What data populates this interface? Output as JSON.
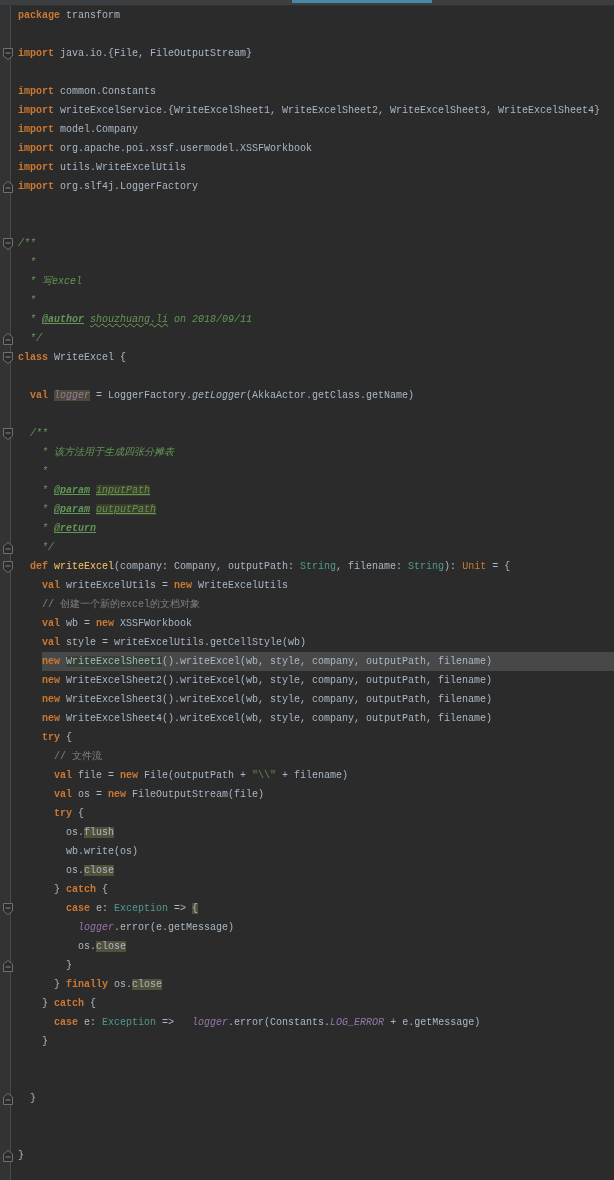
{
  "editor": {
    "lines": [
      {
        "kind": "code",
        "current": false,
        "tokens": [
          {
            "kind": "keyword",
            "text": "package"
          },
          {
            "kind": "plain",
            "text": " transform"
          }
        ]
      },
      {
        "kind": "blank",
        "current": false
      },
      {
        "kind": "code",
        "current": false,
        "fold_start": true,
        "tokens": [
          {
            "kind": "keyword",
            "text": "import"
          },
          {
            "kind": "plain",
            "text": " java.io.{File, FileOutputStream}"
          }
        ]
      },
      {
        "kind": "blank",
        "current": false
      },
      {
        "kind": "code",
        "current": false,
        "tokens": [
          {
            "kind": "keyword",
            "text": "import"
          },
          {
            "kind": "plain",
            "text": " common.Constants"
          }
        ]
      },
      {
        "kind": "code",
        "current": false,
        "tokens": [
          {
            "kind": "keyword",
            "text": "import"
          },
          {
            "kind": "plain",
            "text": " writeExcelService.{WriteExcelSheet1, WriteExcelSheet2, WriteExcelSheet3, WriteExcelSheet4}"
          }
        ]
      },
      {
        "kind": "code",
        "current": false,
        "tokens": [
          {
            "kind": "keyword",
            "text": "import"
          },
          {
            "kind": "plain",
            "text": " model.Company"
          }
        ]
      },
      {
        "kind": "code",
        "current": false,
        "tokens": [
          {
            "kind": "keyword",
            "text": "import"
          },
          {
            "kind": "plain",
            "text": " org.apache.poi.xssf.usermodel.XSSFWorkbook"
          }
        ]
      },
      {
        "kind": "code",
        "current": false,
        "tokens": [
          {
            "kind": "keyword",
            "text": "import"
          },
          {
            "kind": "plain",
            "text": " utils.WriteExcelUtils"
          }
        ]
      },
      {
        "kind": "code",
        "current": false,
        "fold_end": true,
        "tokens": [
          {
            "kind": "keyword",
            "text": "import"
          },
          {
            "kind": "plain",
            "text": " org.slf4j.LoggerFactory"
          }
        ]
      },
      {
        "kind": "blank",
        "current": false
      },
      {
        "kind": "blank",
        "current": false
      },
      {
        "kind": "code",
        "current": false,
        "fold_start": true,
        "tokens": [
          {
            "kind": "doc",
            "text": "/**"
          }
        ],
        "children": [
          {
            "kind": "code",
            "current": false,
            "tokens": [
              {
                "kind": "doc",
                "text": "*"
              }
            ]
          },
          {
            "kind": "code",
            "current": false,
            "tokens": [
              {
                "kind": "doc",
                "text": "* 写excel"
              }
            ]
          },
          {
            "kind": "code",
            "current": false,
            "tokens": [
              {
                "kind": "doc",
                "text": "*"
              }
            ]
          },
          {
            "kind": "code",
            "current": false,
            "tokens": [
              {
                "kind": "doc",
                "text": "* "
              },
              {
                "kind": "doc_tag",
                "text": "@author"
              },
              {
                "kind": "doc_misspelt",
                "text": "shouzhuang.li"
              },
              {
                "kind": "doc",
                "text": " on 2018/09/11"
              }
            ]
          },
          {
            "kind": "code",
            "current": false,
            "fold_end": true,
            "tokens": [
              {
                "kind": "doc",
                "text": "*/"
              }
            ]
          }
        ]
      },
      {
        "kind": "code",
        "current": false,
        "fold_start": true,
        "tokens": [
          {
            "kind": "keyword",
            "text": "class"
          },
          {
            "kind": "plain",
            "text": " WriteExcel {"
          }
        ],
        "children": [
          {
            "kind": "blank",
            "current": false
          },
          {
            "kind": "code",
            "current": false,
            "tokens": [
              {
                "kind": "keyword",
                "text": "val "
              },
              {
                "kind": "field_declaration",
                "text": "logger"
              },
              {
                "kind": "plain",
                "text": " = LoggerFactory."
              },
              {
                "kind": "static_call",
                "text": "getLogger"
              },
              {
                "kind": "plain",
                "text": "(AkkaActor.getClass.getName)"
              }
            ]
          },
          {
            "kind": "blank",
            "current": false
          },
          {
            "kind": "code",
            "current": false,
            "fold_start": true,
            "tokens": [
              {
                "kind": "doc",
                "text": "/**"
              }
            ],
            "children": [
              {
                "kind": "code",
                "current": false,
                "tokens": [
                  {
                    "kind": "doc",
                    "text": "* 该方法用于生成四张分摊表"
                  }
                ]
              },
              {
                "kind": "code",
                "current": false,
                "tokens": [
                  {
                    "kind": "doc",
                    "text": "*"
                  }
                ]
              },
              {
                "kind": "code",
                "current": false,
                "tokens": [
                  {
                    "kind": "doc",
                    "text": "* "
                  },
                  {
                    "kind": "doc_tag",
                    "text": "@param"
                  },
                  {
                    "kind": "doc_param",
                    "text": "inputPath"
                  }
                ]
              },
              {
                "kind": "code",
                "current": false,
                "tokens": [
                  {
                    "kind": "doc",
                    "text": "* "
                  },
                  {
                    "kind": "doc_tag",
                    "text": "@param"
                  },
                  {
                    "kind": "doc_param",
                    "text": "outputPath"
                  }
                ]
              },
              {
                "kind": "code",
                "current": false,
                "tokens": [
                  {
                    "kind": "doc",
                    "text": "* "
                  },
                  {
                    "kind": "doc_tag",
                    "text": "@return"
                  }
                ]
              },
              {
                "kind": "code",
                "current": false,
                "fold_end": true,
                "tokens": [
                  {
                    "kind": "doc",
                    "text": "*/"
                  }
                ]
              }
            ]
          },
          {
            "kind": "code",
            "current": false,
            "fold_start": true,
            "tokens": [
              {
                "kind": "keyword",
                "text": "def "
              },
              {
                "kind": "method_declaration",
                "text": "writeExcel"
              },
              {
                "kind": "plain",
                "text": "(company: Company, outputPath: "
              },
              {
                "kind": "type",
                "text": "String"
              },
              {
                "kind": "plain",
                "text": ", filename: "
              },
              {
                "kind": "type",
                "text": "String"
              },
              {
                "kind": "plain",
                "text": "): "
              },
              {
                "kind": "builtin_type",
                "text": "Unit"
              },
              {
                "kind": "plain",
                "text": " = {"
              }
            ],
            "children": [
              {
                "kind": "code",
                "current": false,
                "tokens": [
                  {
                    "kind": "keyword",
                    "text": "val"
                  },
                  {
                    "kind": "plain",
                    "text": " writeExcelUtils = "
                  },
                  {
                    "kind": "keyword",
                    "text": "new"
                  },
                  {
                    "kind": "plain",
                    "text": " WriteExcelUtils"
                  }
                ]
              },
              {
                "kind": "code",
                "current": false,
                "tokens": [
                  {
                    "kind": "comment",
                    "text": "// 创建一个新的excel的文档对象"
                  }
                ]
              },
              {
                "kind": "code",
                "current": false,
                "tokens": [
                  {
                    "kind": "keyword",
                    "text": "val"
                  },
                  {
                    "kind": "plain",
                    "text": " wb = "
                  },
                  {
                    "kind": "keyword",
                    "text": "new"
                  },
                  {
                    "kind": "plain",
                    "text": " XSSFWorkbook"
                  }
                ]
              },
              {
                "kind": "code",
                "current": false,
                "tokens": [
                  {
                    "kind": "keyword",
                    "text": "val"
                  },
                  {
                    "kind": "plain",
                    "text": " style = writeExcelUtils.getCellStyle(wb)"
                  }
                ]
              },
              {
                "kind": "code",
                "current": true,
                "tokens": [
                  {
                    "kind": "keyword",
                    "text": "new "
                  },
                  {
                    "kind": "caret_usage",
                    "text": "WriteExcelSheet1"
                  },
                  {
                    "kind": "plain",
                    "text": "().writeExcel(wb, style, company, outputPath, filename)"
                  }
                ]
              },
              {
                "kind": "code",
                "current": false,
                "tokens": [
                  {
                    "kind": "keyword",
                    "text": "new"
                  },
                  {
                    "kind": "plain",
                    "text": " WriteExcelSheet2().writeExcel(wb, style, company, outputPath, filename)"
                  }
                ]
              },
              {
                "kind": "code",
                "current": false,
                "tokens": [
                  {
                    "kind": "keyword",
                    "text": "new"
                  },
                  {
                    "kind": "plain",
                    "text": " WriteExcelSheet3().writeExcel(wb, style, company, outputPath, filename)"
                  }
                ]
              },
              {
                "kind": "code",
                "current": false,
                "tokens": [
                  {
                    "kind": "keyword",
                    "text": "new"
                  },
                  {
                    "kind": "plain",
                    "text": " WriteExcelSheet4().writeExcel(wb, style, company, outputPath, filename)"
                  }
                ]
              },
              {
                "kind": "code",
                "current": false,
                "tokens": [
                  {
                    "kind": "keyword",
                    "text": "try"
                  },
                  {
                    "kind": "plain",
                    "text": " {"
                  }
                ],
                "children": [
                  {
                    "kind": "code",
                    "current": false,
                    "tokens": [
                      {
                        "kind": "comment",
                        "text": "// 文件流"
                      }
                    ]
                  },
                  {
                    "kind": "code",
                    "current": false,
                    "tokens": [
                      {
                        "kind": "keyword",
                        "text": "val"
                      },
                      {
                        "kind": "plain",
                        "text": " file = "
                      },
                      {
                        "kind": "keyword",
                        "text": "new"
                      },
                      {
                        "kind": "plain",
                        "text": " File(outputPath + "
                      },
                      {
                        "kind": "string",
                        "text": "\"\\\\\""
                      },
                      {
                        "kind": "plain",
                        "text": " + filename)"
                      }
                    ]
                  },
                  {
                    "kind": "code",
                    "current": false,
                    "tokens": [
                      {
                        "kind": "keyword",
                        "text": "val"
                      },
                      {
                        "kind": "plain",
                        "text": " os = "
                      },
                      {
                        "kind": "keyword",
                        "text": "new"
                      },
                      {
                        "kind": "plain",
                        "text": " FileOutputStream(file)"
                      }
                    ]
                  },
                  {
                    "kind": "code",
                    "current": false,
                    "tokens": [
                      {
                        "kind": "keyword",
                        "text": "try"
                      },
                      {
                        "kind": "plain",
                        "text": " {"
                      }
                    ],
                    "children": [
                      {
                        "kind": "code",
                        "current": false,
                        "tokens": [
                          {
                            "kind": "plain",
                            "text": "os."
                          },
                          {
                            "kind": "usage",
                            "text": "flush"
                          }
                        ]
                      },
                      {
                        "kind": "code",
                        "current": false,
                        "tokens": [
                          {
                            "kind": "plain",
                            "text": "wb.write(os)"
                          }
                        ]
                      },
                      {
                        "kind": "code",
                        "current": false,
                        "tokens": [
                          {
                            "kind": "plain",
                            "text": "os."
                          },
                          {
                            "kind": "usage",
                            "text": "close"
                          }
                        ]
                      }
                    ]
                  },
                  {
                    "kind": "code",
                    "current": false,
                    "tokens": [
                      {
                        "kind": "plain",
                        "text": "} "
                      },
                      {
                        "kind": "keyword",
                        "text": "catch"
                      },
                      {
                        "kind": "plain",
                        "text": " {"
                      }
                    ],
                    "children": [
                      {
                        "kind": "code",
                        "current": false,
                        "fold_start": true,
                        "tokens": [
                          {
                            "kind": "keyword",
                            "text": "case"
                          },
                          {
                            "kind": "plain",
                            "text": " e: "
                          },
                          {
                            "kind": "type",
                            "text": "Exception"
                          },
                          {
                            "kind": "plain",
                            "text": " => "
                          },
                          {
                            "kind": "usage",
                            "text": "{"
                          }
                        ],
                        "children": [
                          {
                            "kind": "code",
                            "current": false,
                            "tokens": [
                              {
                                "kind": "field",
                                "text": "logger"
                              },
                              {
                                "kind": "plain",
                                "text": ".error(e.getMessage)"
                              }
                            ]
                          },
                          {
                            "kind": "code",
                            "current": false,
                            "tokens": [
                              {
                                "kind": "plain",
                                "text": "os."
                              },
                              {
                                "kind": "usage",
                                "text": "close"
                              }
                            ]
                          }
                        ]
                      },
                      {
                        "kind": "code",
                        "current": false,
                        "fold_end": true,
                        "tokens": [
                          {
                            "kind": "plain",
                            "text": "}"
                          }
                        ]
                      }
                    ]
                  },
                  {
                    "kind": "code",
                    "current": false,
                    "tokens": [
                      {
                        "kind": "plain",
                        "text": "} "
                      },
                      {
                        "kind": "keyword",
                        "text": "finally"
                      },
                      {
                        "kind": "plain",
                        "text": " os."
                      },
                      {
                        "kind": "usage",
                        "text": "close"
                      }
                    ]
                  }
                ]
              },
              {
                "kind": "code",
                "current": false,
                "tokens": [
                  {
                    "kind": "plain",
                    "text": "} "
                  },
                  {
                    "kind": "keyword",
                    "text": "catch"
                  },
                  {
                    "kind": "plain",
                    "text": " {"
                  }
                ],
                "children": [
                  {
                    "kind": "code",
                    "current": false,
                    "tokens": [
                      {
                        "kind": "keyword",
                        "text": "case"
                      },
                      {
                        "kind": "plain",
                        "text": " e: "
                      },
                      {
                        "kind": "type",
                        "text": "Exception"
                      },
                      {
                        "kind": "plain",
                        "text": " =>   "
                      },
                      {
                        "kind": "field",
                        "text": "logger"
                      },
                      {
                        "kind": "plain",
                        "text": ".error(Constants."
                      },
                      {
                        "kind": "field",
                        "text": "LOG_ERROR"
                      },
                      {
                        "kind": "plain",
                        "text": " + e.getMessage)"
                      }
                    ]
                  }
                ]
              },
              {
                "kind": "code",
                "current": false,
                "tokens": [
                  {
                    "kind": "plain",
                    "text": "}"
                  }
                ]
              },
              {
                "kind": "blank",
                "current": false
              },
              {
                "kind": "blank",
                "current": false
              }
            ]
          },
          {
            "kind": "code",
            "current": false,
            "fold_end": true,
            "tokens": [
              {
                "kind": "plain",
                "text": "}"
              }
            ]
          }
        ]
      },
      {
        "kind": "blank",
        "current": false
      },
      {
        "kind": "blank",
        "current": false
      },
      {
        "kind": "code",
        "current": false,
        "fold_end": true,
        "tokens": [
          {
            "kind": "plain",
            "text": "}"
          }
        ]
      }
    ]
  }
}
